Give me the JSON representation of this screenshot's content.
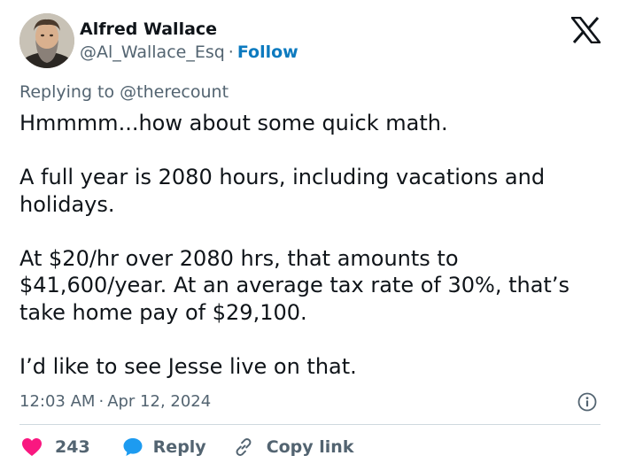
{
  "author": {
    "name": "Alfred Wallace",
    "handle": "@Al_Wallace_Esq",
    "separator": "·",
    "follow_label": "Follow"
  },
  "reply_context": {
    "prefix": "Replying to",
    "handle": "@therecount"
  },
  "tweet": {
    "paragraphs": [
      "Hmmmm...how about some quick math.",
      "A full year is 2080 hours, including vacations and holidays.",
      "At $20/hr over 2080 hrs, that amounts to $41,600/year. At an average tax rate of 30%, that’s take home pay of $29,100.",
      "I’d like to see Jesse live on that."
    ],
    "time": "12:03 AM",
    "separator": "·",
    "date": "Apr 12, 2024"
  },
  "actions": {
    "likes_count": "243",
    "reply_label": "Reply",
    "copy_link_label": "Copy link"
  },
  "icons": {
    "brand_logo": "x-logo",
    "info": "info-icon",
    "like": "heart-icon",
    "reply": "speech-bubble-icon",
    "copy_link": "link-icon"
  },
  "colors": {
    "text_primary": "#0f1419",
    "text_secondary": "#536471",
    "follow_blue": "#0c7abf",
    "like_red": "#f91880",
    "reply_blue": "#1d9bf0",
    "divider": "#cfd9de"
  }
}
